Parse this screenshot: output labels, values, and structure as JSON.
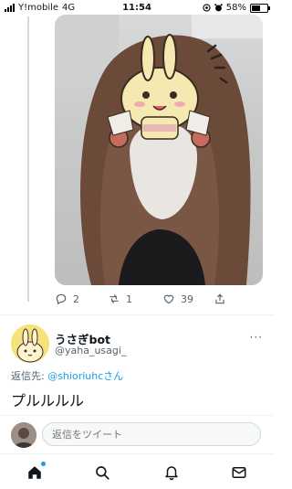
{
  "status_bar": {
    "carrier": "Y!mobile",
    "network": "4G",
    "time": "11:54",
    "battery": "58%",
    "battery_level": 0.58
  },
  "tweet_actions": {
    "replies": "2",
    "retweets": "1",
    "likes": "39"
  },
  "reply_tweet": {
    "display_name": "うさぎbot",
    "handle": "@yaha_usagi_",
    "more": "···",
    "reply_to_label": "返信先: ",
    "reply_to_mention": "@shioriuhc",
    "reply_to_suffix": "さん",
    "text": "プルルルル"
  },
  "composer": {
    "placeholder": "返信をツイート"
  },
  "colors": {
    "accent": "#1d9bf0",
    "muted": "#536471",
    "divider": "#eff3f4"
  },
  "icons": {
    "reply": "reply-icon",
    "retweet": "retweet-icon",
    "like": "heart-icon",
    "share": "share-icon",
    "home": "home-icon",
    "search": "search-icon",
    "notifications": "bell-icon",
    "messages": "mail-icon"
  }
}
